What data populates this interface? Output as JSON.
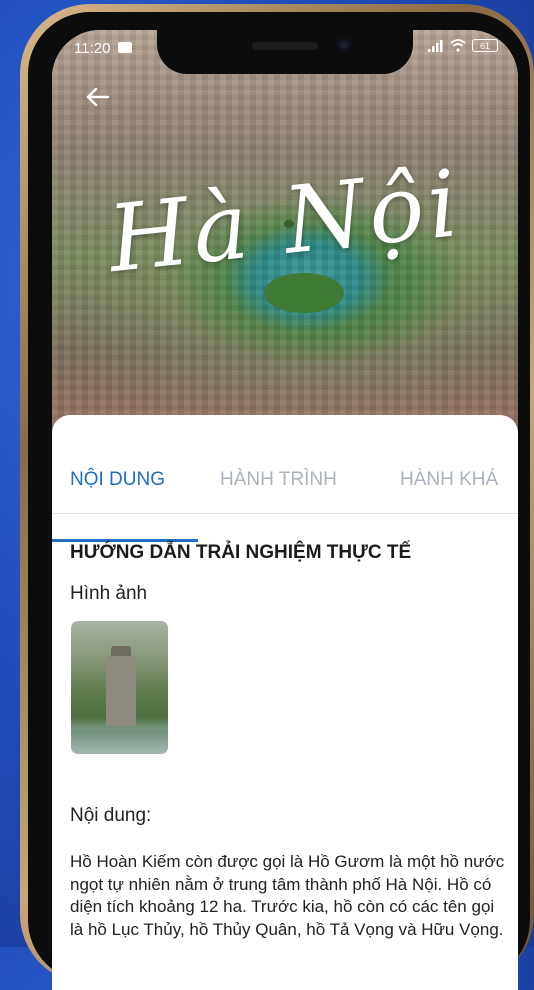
{
  "status_bar": {
    "time": "11:20",
    "battery": "61"
  },
  "hero": {
    "title": "Hà Nội"
  },
  "tabs": [
    {
      "label": "NỘI DUNG",
      "active": true
    },
    {
      "label": "HÀNH TRÌNH",
      "active": false
    },
    {
      "label": "HÀNH KHÁ",
      "active": false
    }
  ],
  "content": {
    "section_title": "HƯỚNG DẪN TRẢI NGHIỆM THỰC TẾ",
    "images_label": "Hình ảnh",
    "content_label": "Nội dung:",
    "body": "Hồ Hoàn Kiếm còn được gọi là Hồ Gươm là một hồ nước ngọt tự nhiên nằm ở trung tâm thành phố Hà Nội. Hồ có diện tích khoảng 12 ha. Trước kia, hồ còn có các tên gọi là hồ Lục Thủy, hồ Thủy Quân, hồ Tả Vọng và Hữu Vọng."
  },
  "colors": {
    "accent": "#1e6fc2",
    "inactive_tab": "#a9b2bd",
    "background": "#1f4cb8"
  },
  "icons": {
    "back": "arrow-left-icon",
    "signal": "signal-icon",
    "wifi": "wifi-icon",
    "battery": "battery-icon",
    "message": "message-icon"
  }
}
